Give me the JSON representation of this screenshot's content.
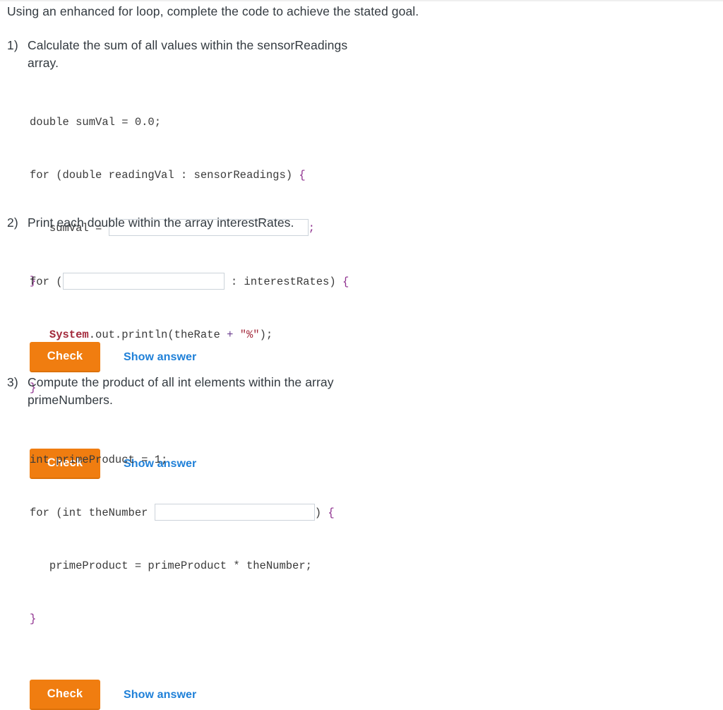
{
  "intro": "Using an enhanced for loop, complete the code to achieve the stated goal.",
  "colors": {
    "accent_orange": "#f07d10",
    "link_blue": "#1f80d8",
    "text": "#333a40",
    "code_text": "#3a3a3a",
    "brace_purple": "#8e2f8e",
    "keyword_maroon": "#a3293b",
    "input_border": "#ccd3da"
  },
  "buttons": {
    "check_label": "Check",
    "show_answer_label": "Show answer"
  },
  "problems": [
    {
      "number": "1)",
      "prompt": "Calculate the sum of all values within the sensorReadings array.",
      "code": {
        "line1": "double sumVal = 0.0;",
        "line2_a": "for (double readingVal : sensorReadings) ",
        "line2_brace": "{",
        "line3_indent": "   sumVal = ",
        "line3_semi": ";",
        "line4_brace": "}"
      },
      "input_value": "",
      "input_placeholder": ""
    },
    {
      "number": "2)",
      "prompt": "Print each double within the array interestRates.",
      "code": {
        "line1_a": "for (",
        "line1_b": " : interestRates) ",
        "line1_brace": "{",
        "line2_indent": "   ",
        "line2_class": "System",
        "line2_mid": ".out.println(theRate ",
        "line2_op": "+",
        "line2_sp": " ",
        "line2_str": "\"%\"",
        "line2_end": ");",
        "line3_brace": "}"
      },
      "input_value": "",
      "input_placeholder": ""
    },
    {
      "number": "3)",
      "prompt": "Compute the product of all int elements within the array primeNumbers.",
      "code": {
        "line1": "int primeProduct = 1;",
        "line2_a": "for (int theNumber ",
        "line2_b": ") ",
        "line2_brace": "{",
        "line3": "   primeProduct = primeProduct * theNumber;",
        "line4_brace": "}"
      },
      "input_value": "",
      "input_placeholder": ""
    }
  ]
}
